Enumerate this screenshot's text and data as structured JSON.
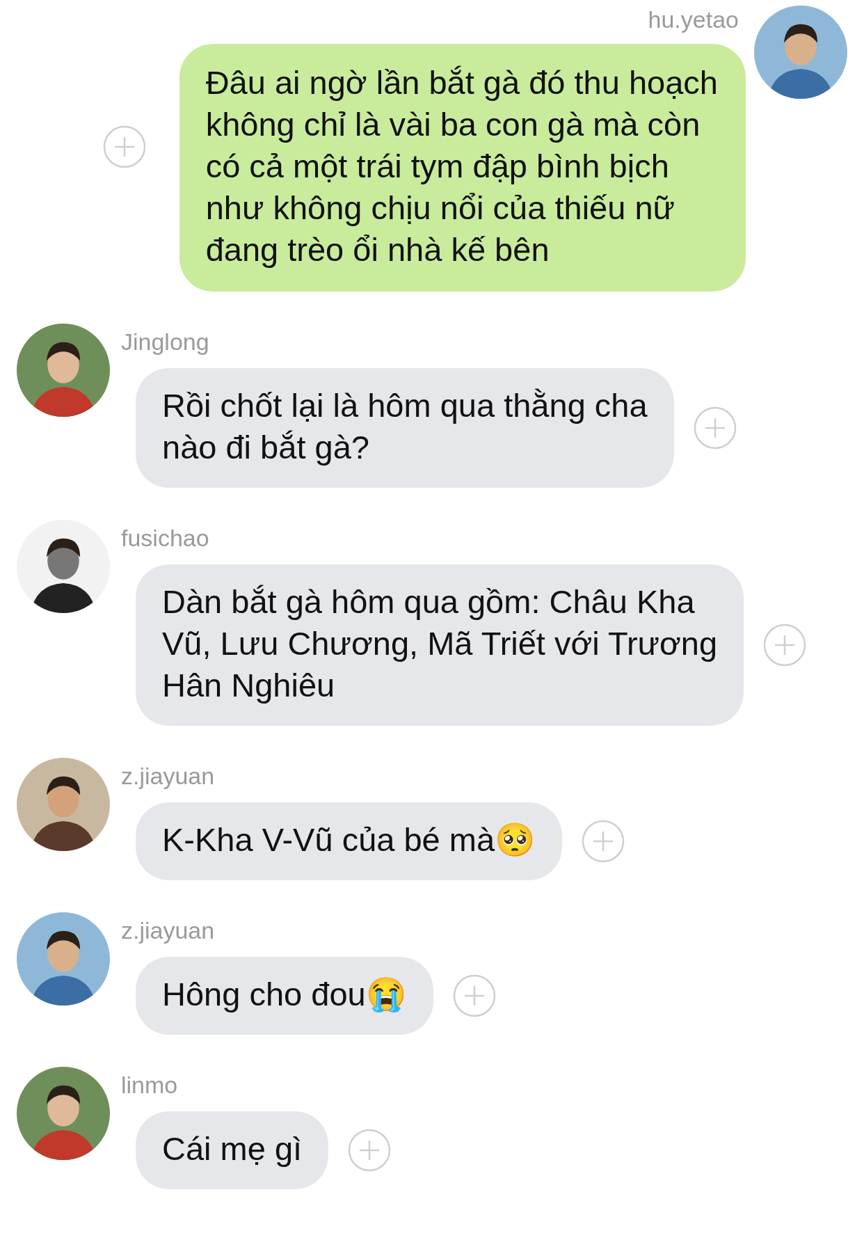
{
  "messages": [
    {
      "kind": "sent",
      "sender": "hu.yetao",
      "text": "Đâu ai ngờ lần bắt gà đó thu hoạch\nkhông chỉ là vài ba con gà mà còn\ncó cả một trái tym đập bình bịch\nnhư không chịu nổi của thiếu nữ\nđang trèo ổi nhà kế bên"
    },
    {
      "kind": "received",
      "sender": "Jinglong",
      "text": "Rồi chốt lại là hôm qua thằng cha\nnào đi bắt gà?"
    },
    {
      "kind": "received",
      "sender": "fusichao",
      "text": "Dàn bắt gà hôm qua gồm: Châu Kha\nVũ, Lưu Chương, Mã Triết với Trương\nHân Nghiêu"
    },
    {
      "kind": "received",
      "sender": "z.jiayuan",
      "text": "K-Kha V-Vũ của bé mà🥺"
    },
    {
      "kind": "received",
      "sender": "z.jiayuan",
      "text": "Hông cho đou😭"
    },
    {
      "kind": "received",
      "sender": "linmo",
      "text": "Cái mẹ gì"
    }
  ]
}
